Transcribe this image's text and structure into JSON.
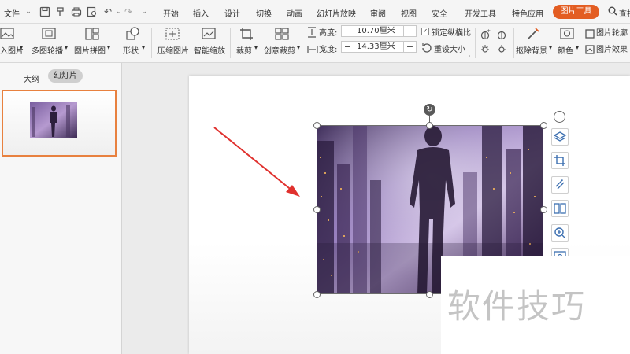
{
  "menubar": {
    "file_label": "文件",
    "tabs": [
      {
        "label": "开始"
      },
      {
        "label": "插入"
      },
      {
        "label": "设计"
      },
      {
        "label": "切换"
      },
      {
        "label": "动画"
      },
      {
        "label": "幻灯片放映"
      },
      {
        "label": "审阅"
      },
      {
        "label": "视图"
      },
      {
        "label": "安全"
      },
      {
        "label": "开发工具"
      },
      {
        "label": "特色应用"
      }
    ],
    "active_tab": "图片工具",
    "search_label": "查找",
    "quick_access_icons": [
      "save-icon",
      "format-painter-icon",
      "print-icon",
      "print-preview-icon",
      "undo-icon",
      "redo-icon",
      "more-icon"
    ]
  },
  "ribbon": {
    "insert_picture": "入图片",
    "multi_outline": "多图轮播",
    "picture_collage": "图片拼图",
    "shape": "形状",
    "compress": "压缩图片",
    "smart_scale": "智能缩放",
    "crop": "裁剪",
    "creative_crop": "创意裁剪",
    "height_label": "高度:",
    "height_value": "10.70厘米",
    "width_label": "宽度:",
    "width_value": "14.33厘米",
    "lock_ratio": "锁定纵横比",
    "lock_ratio_checked": true,
    "reset_size": "重设大小",
    "remove_bg": "抠除背景",
    "color": "颜色",
    "picture_outline": "图片轮廓",
    "picture_effect": "图片效果"
  },
  "left_panel": {
    "tab_outline": "大纲",
    "tab_slides": "幻灯片"
  },
  "watermark": "软件技巧",
  "colors": {
    "accent": "#e35d22",
    "thumb_border": "#e8813f",
    "arrow": "#e0312e"
  }
}
